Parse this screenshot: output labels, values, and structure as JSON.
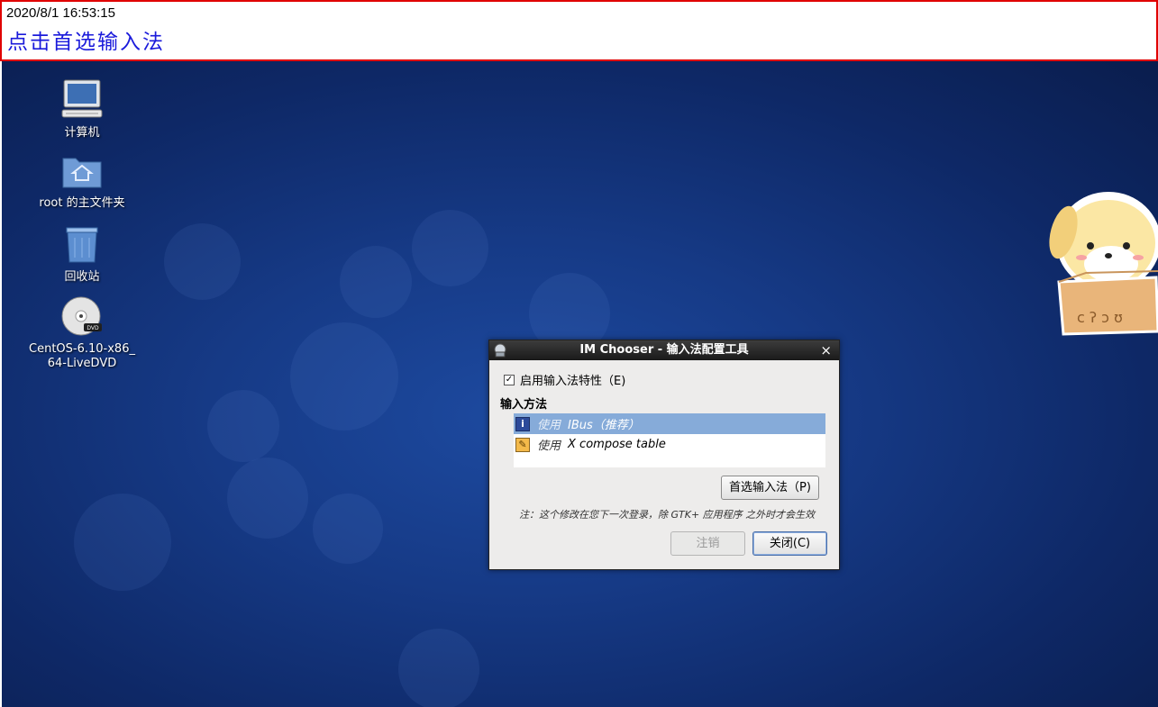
{
  "banner": {
    "timestamp": "2020/8/1 16:53:15",
    "caption": "点击首选输入法"
  },
  "desktop": {
    "icons": [
      {
        "label": "计算机",
        "icon": "computer-icon"
      },
      {
        "label": "root 的主文件夹",
        "icon": "home-folder-icon"
      },
      {
        "label": "回收站",
        "icon": "trash-icon"
      },
      {
        "label": "CentOS-6.10-x86_ 64-LiveDVD",
        "icon": "dvd-icon"
      }
    ]
  },
  "dialog": {
    "title": "IM Chooser - 输入法配置工具",
    "close_glyph": "×",
    "enable_checkbox": {
      "label": "启用输入法特性（E)",
      "checked": true
    },
    "section_title": "输入方法",
    "methods": [
      {
        "use": "使用",
        "name": "IBus（推荐）",
        "selected": true,
        "icon": "info-icon"
      },
      {
        "use": "使用",
        "name": "X compose table",
        "selected": false,
        "icon": "brush-icon"
      }
    ],
    "preferences_button": "首选输入法（P)",
    "note": "注：这个修改在您下一次登录，除 GTK+ 应用程序 之外时才会生效",
    "cancel_button": "注销",
    "close_button": "关闭(C)"
  },
  "colors": {
    "banner_border": "#e00000",
    "caption": "#1a1adb",
    "desktop_bg": "#163a86",
    "selection": "#86abd9"
  }
}
